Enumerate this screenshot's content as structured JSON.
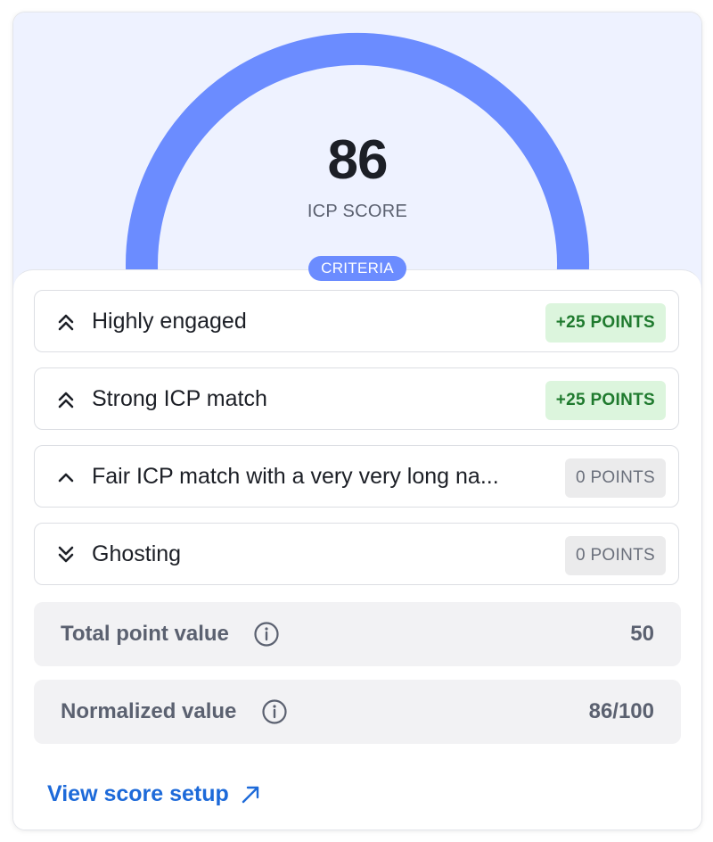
{
  "gauge": {
    "score": "86",
    "score_fraction": 0.86,
    "label": "ICP SCORE",
    "fill_color": "#6b8cff",
    "track_color": "#dfe6ff"
  },
  "criteria": {
    "pill_label": "CRITERIA",
    "items": [
      {
        "icon": "double-chevron-up-icon",
        "label": "Highly engaged",
        "points": "+25 POINTS"
      },
      {
        "icon": "double-chevron-up-icon",
        "label": "Strong ICP match",
        "points": "+25 POINTS"
      },
      {
        "icon": "chevron-up-icon",
        "label": "Fair ICP match with a very very long na...",
        "points": "0 POINTS"
      },
      {
        "icon": "double-chevron-down-icon",
        "label": "Ghosting",
        "points": "0 POINTS"
      }
    ]
  },
  "summary": {
    "total": {
      "label": "Total point value",
      "value": "50"
    },
    "normalized": {
      "label": "Normalized value",
      "value": "86/100"
    }
  },
  "link": {
    "label": "View score setup",
    "icon": "arrow-up-right-icon"
  },
  "colors": {
    "positive_badge_bg": "#dcf5dd",
    "positive_badge_text": "#1f7a2e",
    "neutral_badge_bg": "#ebebec",
    "link": "#1d6ad9"
  }
}
